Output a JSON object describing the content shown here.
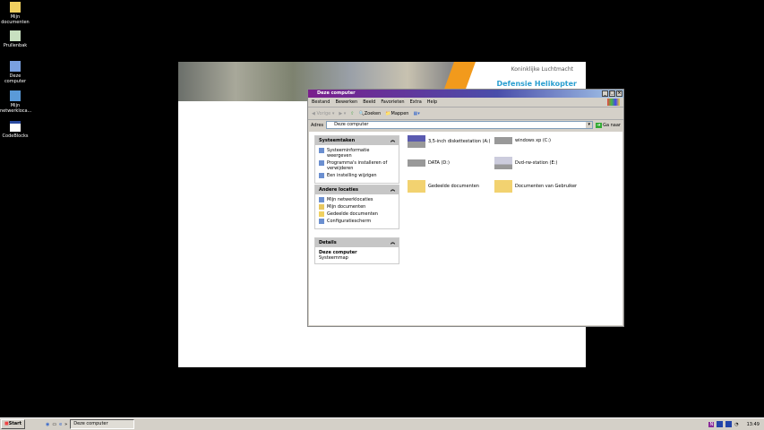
{
  "desktop": {
    "icons": [
      {
        "label": "Mijn documenten"
      },
      {
        "label": "Prullenbak"
      },
      {
        "label": "Deze computer"
      },
      {
        "label": "Mijn netwerkloca..."
      },
      {
        "label": "CodeBlocks"
      }
    ]
  },
  "webpage": {
    "line1": "Koninklijke Luchtmacht",
    "line2": "Defensie Helikopter"
  },
  "window": {
    "title": "Deze computer",
    "menu": [
      "Bestand",
      "Bewerken",
      "Beeld",
      "Favorieten",
      "Extra",
      "Help"
    ],
    "toolbar": {
      "back": "Vorige",
      "search": "Zoeken",
      "folders": "Mappen"
    },
    "address": {
      "label": "Adres",
      "value": "Deze computer",
      "go": "Ga naar"
    },
    "panels": [
      {
        "title": "Systeemtaken",
        "items": [
          "Systeeminformatie weergeven",
          "Programma's installeren of verwijderen",
          "Een instelling wijzigen"
        ]
      },
      {
        "title": "Andere locaties",
        "items": [
          "Mijn netwerklocaties",
          "Mijn documenten",
          "Gedeelde documenten",
          "Configuratiescherm"
        ]
      },
      {
        "title": "Details",
        "name": "Deze computer",
        "type": "Systeemmap"
      }
    ],
    "items": [
      {
        "label": "3,5-inch diskettestation (A:)",
        "icon": "floppy"
      },
      {
        "label": "windows xp (C:)",
        "icon": "drive"
      },
      {
        "label": "DATA (D:)",
        "icon": "drive"
      },
      {
        "label": "Dvd-rw-station (E:)",
        "icon": "dvd"
      },
      {
        "label": "Gedeelde documenten",
        "icon": "shared-folder"
      },
      {
        "label": "Documenten van Gebruiker",
        "icon": "folder"
      }
    ]
  },
  "taskbar": {
    "start": "Start",
    "task": "Deze computer",
    "clock": "13:49"
  }
}
